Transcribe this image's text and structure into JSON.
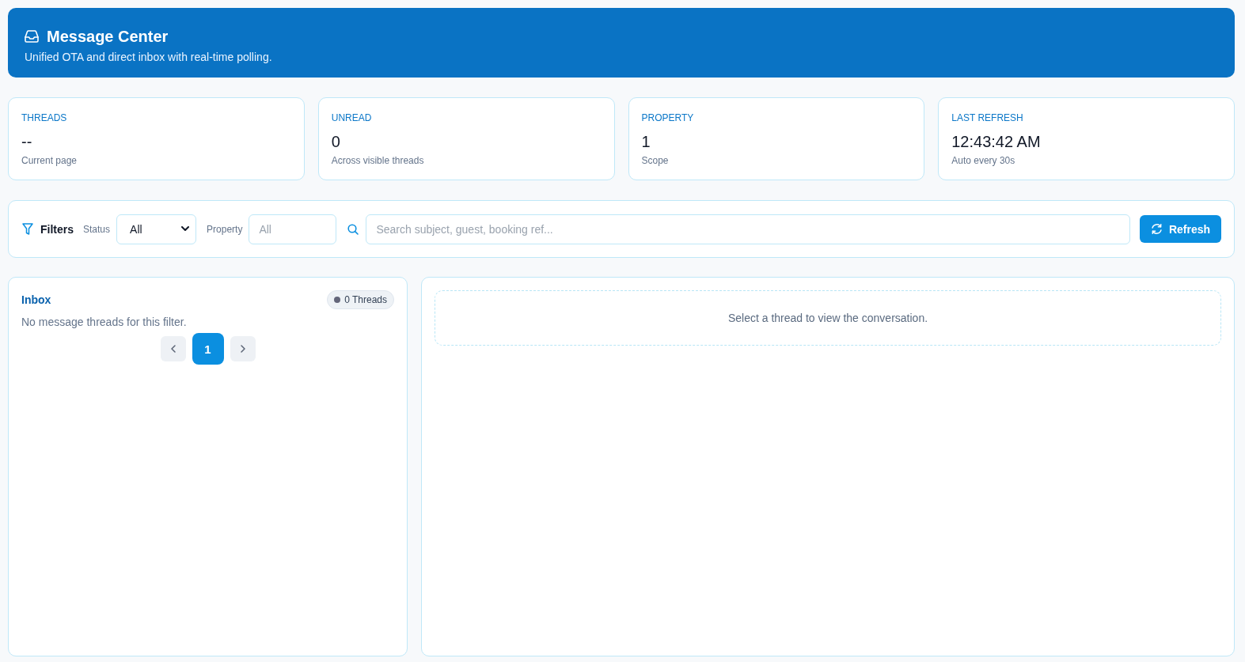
{
  "header": {
    "title": "Message Center",
    "subtitle": "Unified OTA and direct inbox with real-time polling."
  },
  "stats": [
    {
      "label": "THREADS",
      "value": "--",
      "note": "Current page"
    },
    {
      "label": "UNREAD",
      "value": "0",
      "note": "Across visible threads"
    },
    {
      "label": "PROPERTY",
      "value": "1",
      "note": "Scope"
    },
    {
      "label": "LAST REFRESH",
      "value": "12:43:42 AM",
      "note": "Auto every 30s"
    }
  ],
  "filters": {
    "title": "Filters",
    "status": {
      "label": "Status",
      "value": "All"
    },
    "property": {
      "label": "Property",
      "placeholder": "All"
    },
    "search": {
      "placeholder": "Search subject, guest, booking ref..."
    },
    "refresh_button": "Refresh"
  },
  "inbox": {
    "title": "Inbox",
    "badge": "0 Threads",
    "empty_text": "No message threads for this filter.",
    "pages": [
      {
        "label": "1",
        "selected": true
      }
    ]
  },
  "conversation": {
    "empty_text": "Select a thread to view the conversation."
  }
}
